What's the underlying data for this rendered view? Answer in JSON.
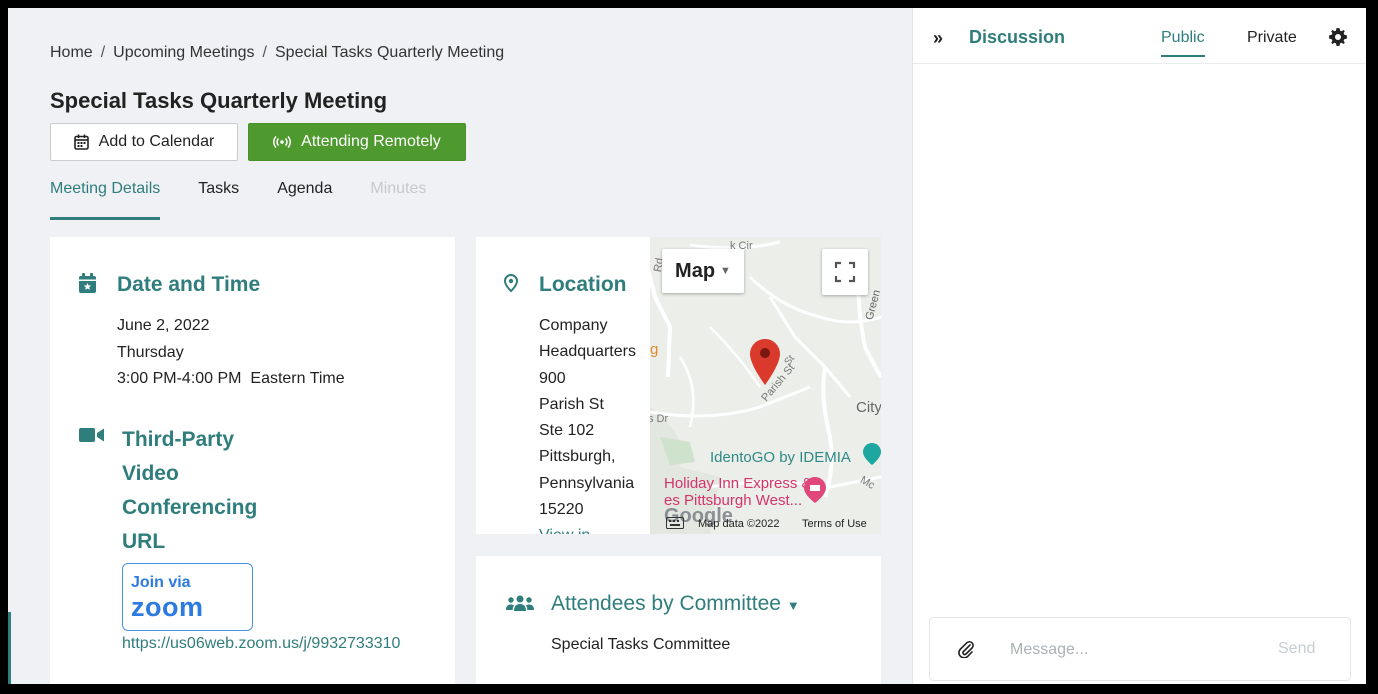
{
  "breadcrumb": {
    "items": [
      "Home",
      "Upcoming Meetings",
      "Special Tasks Quarterly Meeting"
    ],
    "separator": "/"
  },
  "page": {
    "title": "Special Tasks Quarterly Meeting"
  },
  "actions": {
    "add_calendar": "Add to Calendar",
    "attending_remotely": "Attending Remotely"
  },
  "tabs": [
    "Meeting Details",
    "Tasks",
    "Agenda",
    "Minutes"
  ],
  "date_time": {
    "title": "Date and Time",
    "date": "June 2, 2022",
    "weekday": "Thursday",
    "time": "3:00 PM-4:00 PM  Eastern Time"
  },
  "video": {
    "title_lines": [
      "Third-Party",
      "Video",
      "Conferencing",
      "URL"
    ],
    "join_label": "Join via",
    "logo_text": "zoom",
    "url": "https://us06web.zoom.us/j/9932733310"
  },
  "location": {
    "title": "Location",
    "lines": [
      "Company",
      "Headquarters",
      "900",
      "Parish St",
      "Ste 102",
      "Pittsburgh,",
      "Pennsylvania",
      "15220"
    ],
    "link": "View in"
  },
  "map": {
    "type_button": "Map",
    "attribution": "Map data ©2022",
    "terms": "Terms of Use",
    "labels": {
      "road_top": "k Cir",
      "road_rd": "Rd",
      "street": "Parish St",
      "street_st": "St",
      "green": "Green",
      "city": "City",
      "poi1": "IdentoGO by IDEMIA",
      "poi2": "Holiday Inn Express &",
      "poi2b": "es Pittsburgh West...",
      "s_dr": "s Dr",
      "mc": "Mc",
      "google": "Google",
      "edge_g": "g"
    }
  },
  "attendees": {
    "title": "Attendees by",
    "dropdown": "Committee",
    "committee": "Special Tasks Committee"
  },
  "discussion": {
    "title": "Discussion",
    "tabs": [
      "Public",
      "Private"
    ],
    "placeholder": "Message...",
    "send": "Send"
  },
  "colors": {
    "accent": "#2f7d7c",
    "success": "#4f9a2f",
    "zoom": "#2d7ae0",
    "map_pin": "#d93a2b"
  }
}
